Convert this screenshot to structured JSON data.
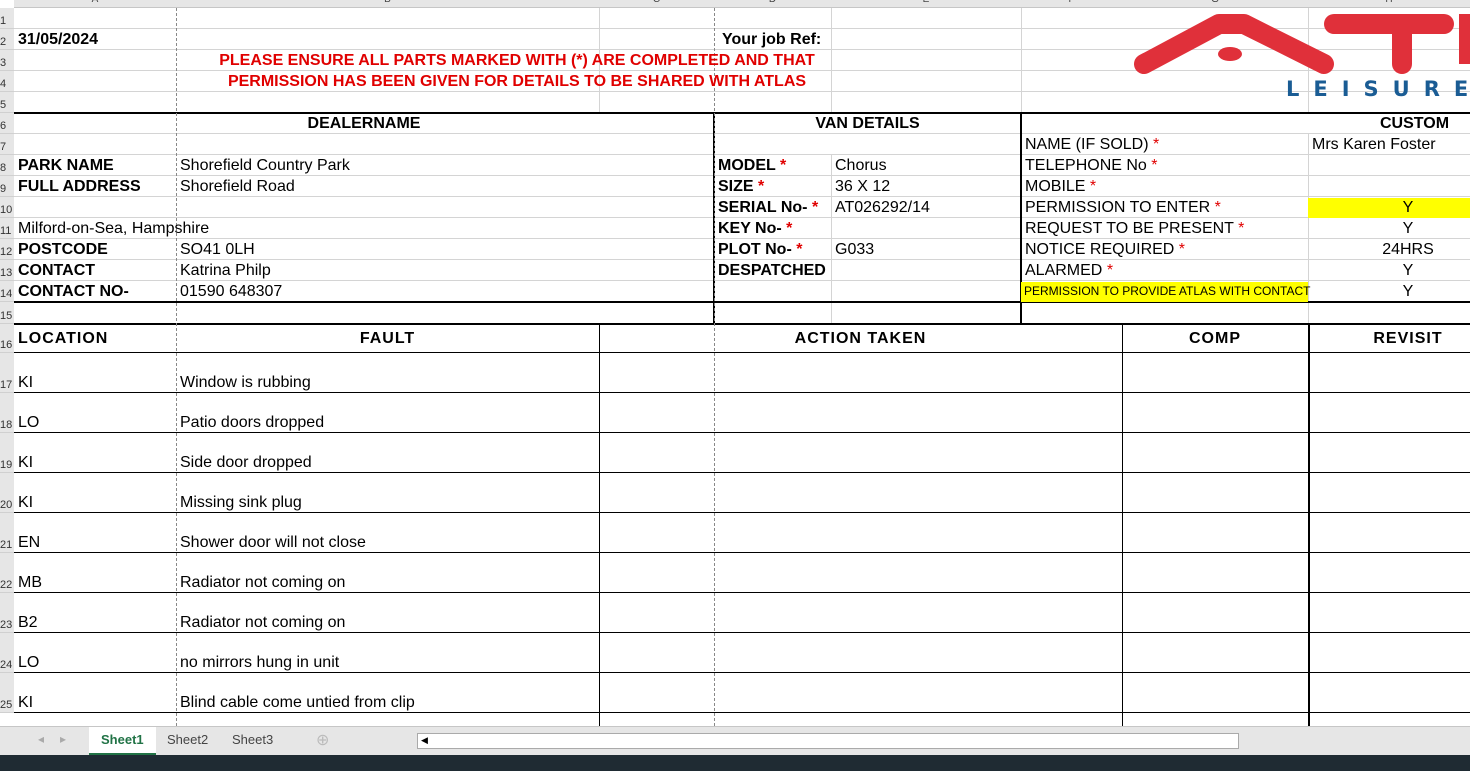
{
  "columns": [
    "A",
    "B",
    "C",
    "D",
    "E",
    "F",
    "G",
    "H",
    "I"
  ],
  "rows": [
    "1",
    "2",
    "3",
    "4",
    "5",
    "6",
    "7",
    "8",
    "9",
    "10",
    "11",
    "12",
    "13",
    "14",
    "15",
    "16",
    "17",
    "18",
    "19",
    "20",
    "21",
    "22",
    "23",
    "24",
    "25"
  ],
  "header": {
    "date": "31/05/2024",
    "job_ref_label": "Your job Ref:",
    "notice_line1": "PLEASE ENSURE ALL PARTS MARKED WITH (*) ARE COMPLETED AND THAT",
    "notice_line2": "PERMISSION HAS BEEN GIVEN FOR DETAILS TO BE SHARED WITH ATLAS"
  },
  "logo": {
    "text": "ATLAS LEISURE",
    "colors": {
      "red": "#e0303a",
      "blue": "#1a5c94"
    }
  },
  "dealer": {
    "title": "DEALERNAME",
    "park_name_label": "PARK NAME",
    "park_name": "Shorefield Country Park",
    "address_label": "FULL ADDRESS",
    "address1": "Shorefield Road",
    "address2": "Milford-on-Sea, Hampshire",
    "postcode_label": "POSTCODE",
    "postcode": "SO41 0LH",
    "contact_label": "CONTACT",
    "contact": "Katrina Philp",
    "contact_no_label": "CONTACT NO-",
    "contact_no": "01590 648307"
  },
  "van": {
    "title": "VAN DETAILS",
    "star": "*",
    "model_label": "MODEL",
    "model": "Chorus",
    "size_label": "SIZE",
    "size": "36 X 12",
    "serial_label": "SERIAL No-",
    "serial": "AT026292/14",
    "key_label": "KEY No-",
    "key": "",
    "plot_label": "PLOT No-",
    "plot": "G033",
    "despatched_label": "DESPATCHED"
  },
  "customer": {
    "title": "CUSTOM",
    "name_label": "NAME (IF SOLD)",
    "name": "Mrs Karen Foster",
    "telephone_label": "TELEPHONE No",
    "mobile_label": "MOBILE",
    "permission_enter_label": "PERMISSION TO ENTER",
    "permission_enter": "Y",
    "request_present_label": "REQUEST TO BE PRESENT",
    "request_present": "Y",
    "notice_label": "NOTICE REQUIRED",
    "notice": "24HRS",
    "alarmed_label": "ALARMED",
    "alarmed": "Y",
    "permission_contact_label": "PERMISSION TO PROVIDE ATLAS WITH CONTACT",
    "permission_contact": "Y"
  },
  "faults_header": {
    "location": "LOCATION",
    "fault": "FAULT",
    "action": "ACTION TAKEN",
    "comp": "COMP",
    "revisit": "REVISIT"
  },
  "faults": [
    {
      "location": "KI",
      "fault": "Window is rubbing"
    },
    {
      "location": "LO",
      "fault": "Patio doors dropped"
    },
    {
      "location": "KI",
      "fault": "Side door dropped"
    },
    {
      "location": "KI",
      "fault": "Missing sink plug"
    },
    {
      "location": "EN",
      "fault": "Shower door will not close"
    },
    {
      "location": "MB",
      "fault": "Radiator not coming on"
    },
    {
      "location": "B2",
      "fault": "Radiator not coming on"
    },
    {
      "location": "LO",
      "fault": "no mirrors hung in unit"
    },
    {
      "location": "KI",
      "fault": "Blind cable come untied from clip"
    }
  ],
  "sheet_tabs": [
    {
      "label": "Sheet1",
      "active": true
    },
    {
      "label": "Sheet2"
    },
    {
      "label": "Sheet3"
    }
  ],
  "highlight_color": "#ffff00"
}
